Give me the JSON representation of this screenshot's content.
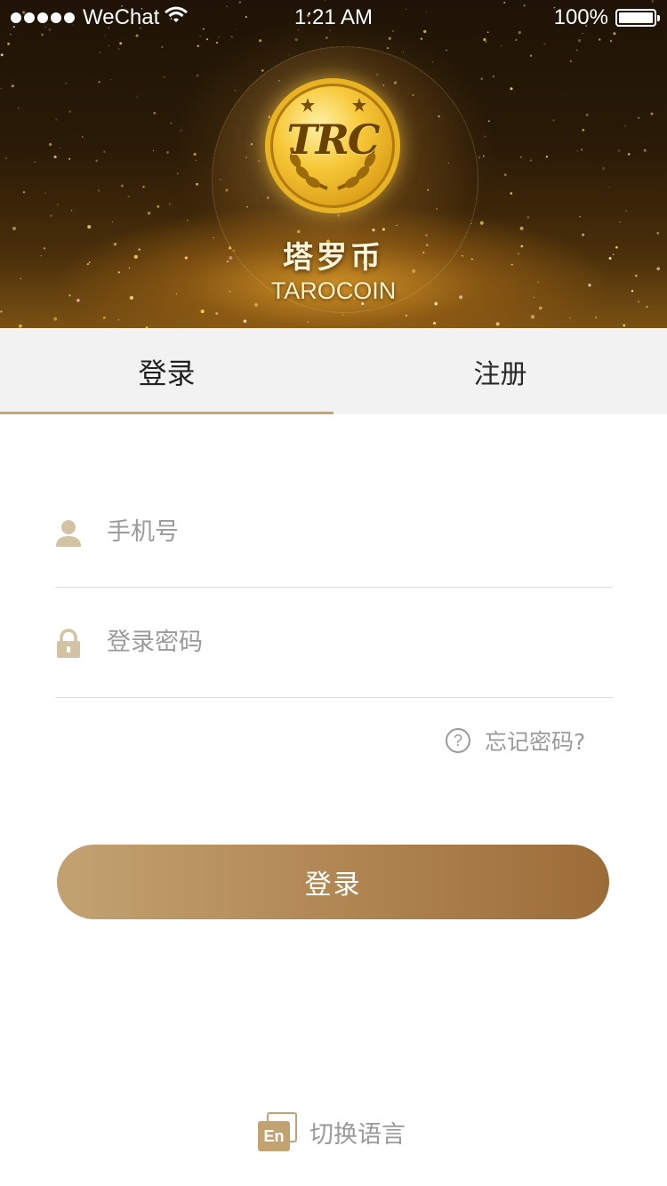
{
  "status_bar": {
    "carrier": "WeChat",
    "time": "1:21 AM",
    "battery": "100%"
  },
  "hero": {
    "coin_text": "TRC",
    "brand_cn": "塔罗币",
    "brand_en": "TAROCOIN"
  },
  "tabs": {
    "login": "登录",
    "register": "注册",
    "active": "login"
  },
  "form": {
    "phone_placeholder": "手机号",
    "password_placeholder": "登录密码",
    "forgot_label": "忘记密码?",
    "help_glyph": "?",
    "login_button": "登录"
  },
  "footer": {
    "lang_icon_text": "En",
    "switch_language": "切换语言"
  },
  "colors": {
    "accent": "#c3a272",
    "button_start": "#c3a272",
    "button_end": "#9c6c38",
    "tab_bg": "#f2f2f2",
    "placeholder": "#9a9a9a"
  }
}
